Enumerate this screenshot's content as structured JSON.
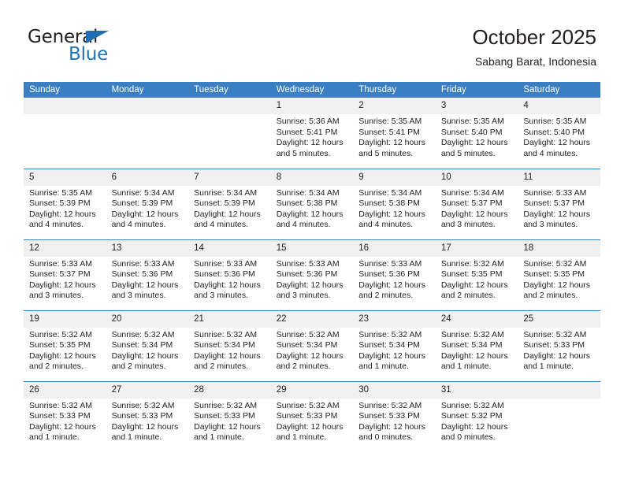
{
  "brand": {
    "name_part1": "General",
    "name_part2": "Blue",
    "flag_icon": "triangle-flag-icon"
  },
  "header": {
    "title": "October 2025",
    "subtitle": "Sabang Barat, Indonesia",
    "accent_color": "#3a7fc1",
    "brand_blue": "#1f72b8"
  },
  "calendar": {
    "weekday_headers": [
      "Sunday",
      "Monday",
      "Tuesday",
      "Wednesday",
      "Thursday",
      "Friday",
      "Saturday"
    ],
    "weeks": [
      [
        {
          "day": "",
          "empty": true,
          "sunrise": "",
          "sunset": "",
          "daylight": ""
        },
        {
          "day": "",
          "empty": true,
          "sunrise": "",
          "sunset": "",
          "daylight": ""
        },
        {
          "day": "",
          "empty": true,
          "sunrise": "",
          "sunset": "",
          "daylight": ""
        },
        {
          "day": "1",
          "empty": false,
          "sunrise": "Sunrise: 5:36 AM",
          "sunset": "Sunset: 5:41 PM",
          "daylight": "Daylight: 12 hours and 5 minutes."
        },
        {
          "day": "2",
          "empty": false,
          "sunrise": "Sunrise: 5:35 AM",
          "sunset": "Sunset: 5:41 PM",
          "daylight": "Daylight: 12 hours and 5 minutes."
        },
        {
          "day": "3",
          "empty": false,
          "sunrise": "Sunrise: 5:35 AM",
          "sunset": "Sunset: 5:40 PM",
          "daylight": "Daylight: 12 hours and 5 minutes."
        },
        {
          "day": "4",
          "empty": false,
          "sunrise": "Sunrise: 5:35 AM",
          "sunset": "Sunset: 5:40 PM",
          "daylight": "Daylight: 12 hours and 4 minutes."
        }
      ],
      [
        {
          "day": "5",
          "empty": false,
          "sunrise": "Sunrise: 5:35 AM",
          "sunset": "Sunset: 5:39 PM",
          "daylight": "Daylight: 12 hours and 4 minutes."
        },
        {
          "day": "6",
          "empty": false,
          "sunrise": "Sunrise: 5:34 AM",
          "sunset": "Sunset: 5:39 PM",
          "daylight": "Daylight: 12 hours and 4 minutes."
        },
        {
          "day": "7",
          "empty": false,
          "sunrise": "Sunrise: 5:34 AM",
          "sunset": "Sunset: 5:39 PM",
          "daylight": "Daylight: 12 hours and 4 minutes."
        },
        {
          "day": "8",
          "empty": false,
          "sunrise": "Sunrise: 5:34 AM",
          "sunset": "Sunset: 5:38 PM",
          "daylight": "Daylight: 12 hours and 4 minutes."
        },
        {
          "day": "9",
          "empty": false,
          "sunrise": "Sunrise: 5:34 AM",
          "sunset": "Sunset: 5:38 PM",
          "daylight": "Daylight: 12 hours and 4 minutes."
        },
        {
          "day": "10",
          "empty": false,
          "sunrise": "Sunrise: 5:34 AM",
          "sunset": "Sunset: 5:37 PM",
          "daylight": "Daylight: 12 hours and 3 minutes."
        },
        {
          "day": "11",
          "empty": false,
          "sunrise": "Sunrise: 5:33 AM",
          "sunset": "Sunset: 5:37 PM",
          "daylight": "Daylight: 12 hours and 3 minutes."
        }
      ],
      [
        {
          "day": "12",
          "empty": false,
          "sunrise": "Sunrise: 5:33 AM",
          "sunset": "Sunset: 5:37 PM",
          "daylight": "Daylight: 12 hours and 3 minutes."
        },
        {
          "day": "13",
          "empty": false,
          "sunrise": "Sunrise: 5:33 AM",
          "sunset": "Sunset: 5:36 PM",
          "daylight": "Daylight: 12 hours and 3 minutes."
        },
        {
          "day": "14",
          "empty": false,
          "sunrise": "Sunrise: 5:33 AM",
          "sunset": "Sunset: 5:36 PM",
          "daylight": "Daylight: 12 hours and 3 minutes."
        },
        {
          "day": "15",
          "empty": false,
          "sunrise": "Sunrise: 5:33 AM",
          "sunset": "Sunset: 5:36 PM",
          "daylight": "Daylight: 12 hours and 3 minutes."
        },
        {
          "day": "16",
          "empty": false,
          "sunrise": "Sunrise: 5:33 AM",
          "sunset": "Sunset: 5:36 PM",
          "daylight": "Daylight: 12 hours and 2 minutes."
        },
        {
          "day": "17",
          "empty": false,
          "sunrise": "Sunrise: 5:32 AM",
          "sunset": "Sunset: 5:35 PM",
          "daylight": "Daylight: 12 hours and 2 minutes."
        },
        {
          "day": "18",
          "empty": false,
          "sunrise": "Sunrise: 5:32 AM",
          "sunset": "Sunset: 5:35 PM",
          "daylight": "Daylight: 12 hours and 2 minutes."
        }
      ],
      [
        {
          "day": "19",
          "empty": false,
          "sunrise": "Sunrise: 5:32 AM",
          "sunset": "Sunset: 5:35 PM",
          "daylight": "Daylight: 12 hours and 2 minutes."
        },
        {
          "day": "20",
          "empty": false,
          "sunrise": "Sunrise: 5:32 AM",
          "sunset": "Sunset: 5:34 PM",
          "daylight": "Daylight: 12 hours and 2 minutes."
        },
        {
          "day": "21",
          "empty": false,
          "sunrise": "Sunrise: 5:32 AM",
          "sunset": "Sunset: 5:34 PM",
          "daylight": "Daylight: 12 hours and 2 minutes."
        },
        {
          "day": "22",
          "empty": false,
          "sunrise": "Sunrise: 5:32 AM",
          "sunset": "Sunset: 5:34 PM",
          "daylight": "Daylight: 12 hours and 2 minutes."
        },
        {
          "day": "23",
          "empty": false,
          "sunrise": "Sunrise: 5:32 AM",
          "sunset": "Sunset: 5:34 PM",
          "daylight": "Daylight: 12 hours and 1 minute."
        },
        {
          "day": "24",
          "empty": false,
          "sunrise": "Sunrise: 5:32 AM",
          "sunset": "Sunset: 5:34 PM",
          "daylight": "Daylight: 12 hours and 1 minute."
        },
        {
          "day": "25",
          "empty": false,
          "sunrise": "Sunrise: 5:32 AM",
          "sunset": "Sunset: 5:33 PM",
          "daylight": "Daylight: 12 hours and 1 minute."
        }
      ],
      [
        {
          "day": "26",
          "empty": false,
          "sunrise": "Sunrise: 5:32 AM",
          "sunset": "Sunset: 5:33 PM",
          "daylight": "Daylight: 12 hours and 1 minute."
        },
        {
          "day": "27",
          "empty": false,
          "sunrise": "Sunrise: 5:32 AM",
          "sunset": "Sunset: 5:33 PM",
          "daylight": "Daylight: 12 hours and 1 minute."
        },
        {
          "day": "28",
          "empty": false,
          "sunrise": "Sunrise: 5:32 AM",
          "sunset": "Sunset: 5:33 PM",
          "daylight": "Daylight: 12 hours and 1 minute."
        },
        {
          "day": "29",
          "empty": false,
          "sunrise": "Sunrise: 5:32 AM",
          "sunset": "Sunset: 5:33 PM",
          "daylight": "Daylight: 12 hours and 1 minute."
        },
        {
          "day": "30",
          "empty": false,
          "sunrise": "Sunrise: 5:32 AM",
          "sunset": "Sunset: 5:33 PM",
          "daylight": "Daylight: 12 hours and 0 minutes."
        },
        {
          "day": "31",
          "empty": false,
          "sunrise": "Sunrise: 5:32 AM",
          "sunset": "Sunset: 5:32 PM",
          "daylight": "Daylight: 12 hours and 0 minutes."
        },
        {
          "day": "",
          "empty": true,
          "sunrise": "",
          "sunset": "",
          "daylight": ""
        }
      ]
    ]
  }
}
